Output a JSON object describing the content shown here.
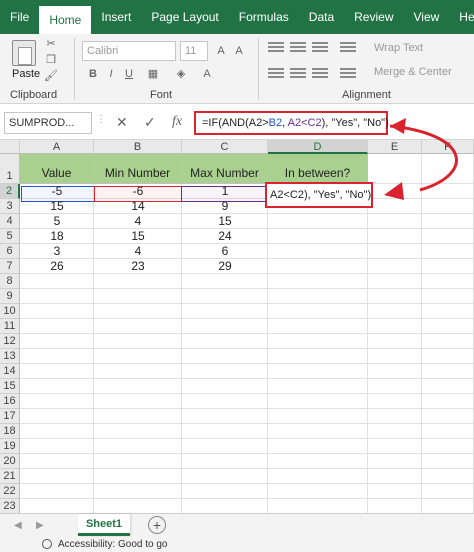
{
  "ribbon_tabs": [
    "File",
    "Home",
    "Insert",
    "Page Layout",
    "Formulas",
    "Data",
    "Review",
    "View",
    "Help"
  ],
  "active_tab": "Home",
  "ribbon": {
    "paste_label": "Paste",
    "clipboard_label": "Clipboard",
    "font_name": "Calibri",
    "font_size": "11",
    "font_label": "Font",
    "wrap_text": "Wrap Text",
    "merge_center": "Merge & Center",
    "alignment_label": "Alignment"
  },
  "formula_bar": {
    "name_box": "SUMPROD...",
    "fx": "fx",
    "formula_prefix": "=IF(AND(",
    "formula_a2": "A2>",
    "formula_b2": "B2",
    "formula_mid": ", ",
    "formula_c2": "A2<C2",
    "formula_suffix": "), \"Yes\", \"No\")"
  },
  "columns": [
    "A",
    "B",
    "C",
    "D",
    "E",
    "F"
  ],
  "rows": [
    "1",
    "2",
    "3",
    "4",
    "5",
    "6",
    "7",
    "8",
    "9",
    "10",
    "11",
    "12",
    "13",
    "14",
    "15",
    "16",
    "17",
    "18",
    "19",
    "20",
    "21",
    "22",
    "23"
  ],
  "table": {
    "headers": [
      "Value",
      "Min Number",
      "Max Number",
      "In between?"
    ],
    "data": [
      [
        "-5",
        "-6",
        "1"
      ],
      [
        "15",
        "14",
        "9"
      ],
      [
        "5",
        "4",
        "15"
      ],
      [
        "18",
        "15",
        "24"
      ],
      [
        "3",
        "4",
        "6"
      ],
      [
        "26",
        "23",
        "29"
      ]
    ]
  },
  "edit_cell_text": "A2<C2), \"Yes\", \"No\")",
  "sheet_tab": "Sheet1",
  "status_text": "Accessibility: Good to go",
  "accent_color": "#217346",
  "highlight_color": "#d9232e"
}
